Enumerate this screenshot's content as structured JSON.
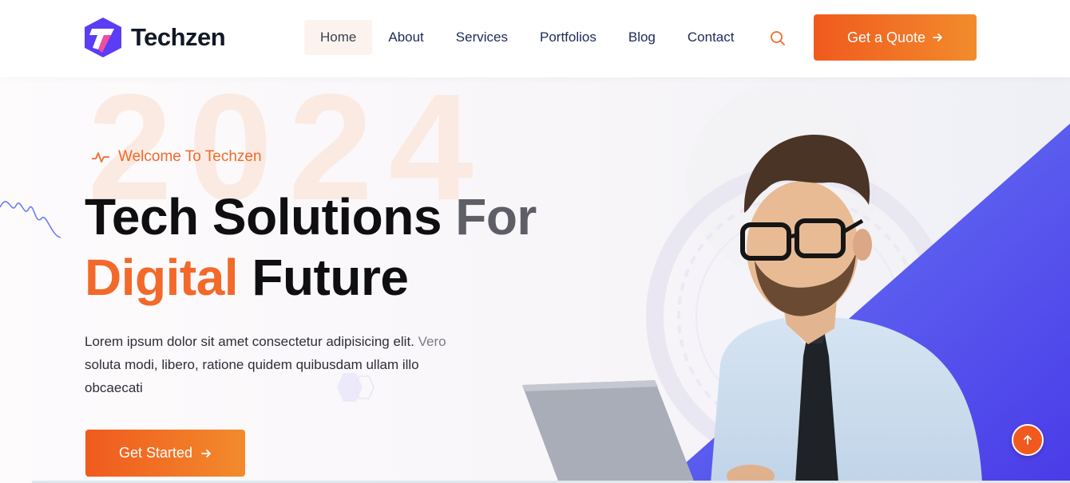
{
  "brand": {
    "name": "Techzen",
    "accent": "#f2692a",
    "logo_color": "#5b3df5"
  },
  "nav": {
    "items": [
      {
        "label": "Home",
        "active": true
      },
      {
        "label": "About"
      },
      {
        "label": "Services"
      },
      {
        "label": "Portfolios"
      },
      {
        "label": "Blog"
      },
      {
        "label": "Contact"
      }
    ],
    "search_icon": "search-icon",
    "quote_label": "Get a Quote"
  },
  "hero": {
    "background_year": "2024",
    "tagline": "Welcome To Techzen",
    "title_line1_a": "Tech Solutions",
    "title_line1_b": "For",
    "title_line2_a": "Digital",
    "title_line2_b": "Future",
    "description_a": "Lorem ipsum dolor sit amet consectetur adipisicing elit.",
    "description_b": "Vero",
    "description_c": "soluta modi, libero, ratione quidem quibusdam ullam illo obcaecati",
    "cta_label": "Get Started"
  },
  "scroll_top_icon": "arrow-up-icon"
}
